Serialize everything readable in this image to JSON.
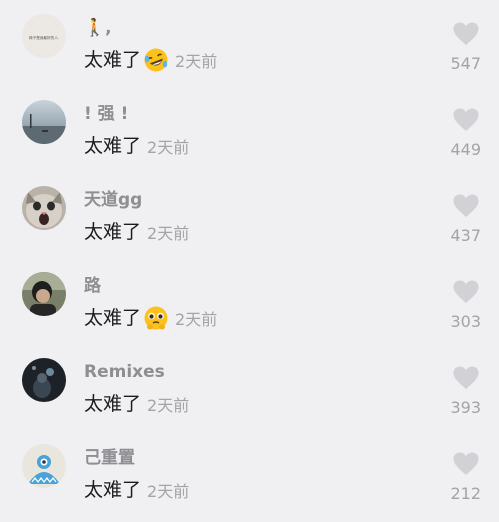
{
  "comments": [
    {
      "username": "🚶,",
      "text": "太难了",
      "emoji": "rolling-on-floor-laughing-emoji",
      "time": "2天前",
      "likes": "547",
      "avatar_text": "椅子是我最好的人."
    },
    {
      "username": "! 强 !",
      "text": "太难了",
      "emoji": "",
      "time": "2天前",
      "likes": "449"
    },
    {
      "username": "天道gg",
      "text": "太难了",
      "emoji": "",
      "time": "2天前",
      "likes": "437"
    },
    {
      "username": "路",
      "text": "太难了",
      "emoji": "pleading-face-emoji",
      "time": "2天前",
      "likes": "303"
    },
    {
      "username": "Remixes",
      "text": "太难了",
      "emoji": "",
      "time": "2天前",
      "likes": "393"
    },
    {
      "username": "己重置",
      "text": "太难了",
      "emoji": "",
      "time": "2天前",
      "likes": "212"
    }
  ],
  "icons": {
    "like": "heart-icon"
  },
  "colors": {
    "background": "#f0f0f2",
    "username": "#8e8e93",
    "text": "#1c1c1e",
    "meta": "#a3a3a8",
    "heart": "#d1d1d6"
  }
}
